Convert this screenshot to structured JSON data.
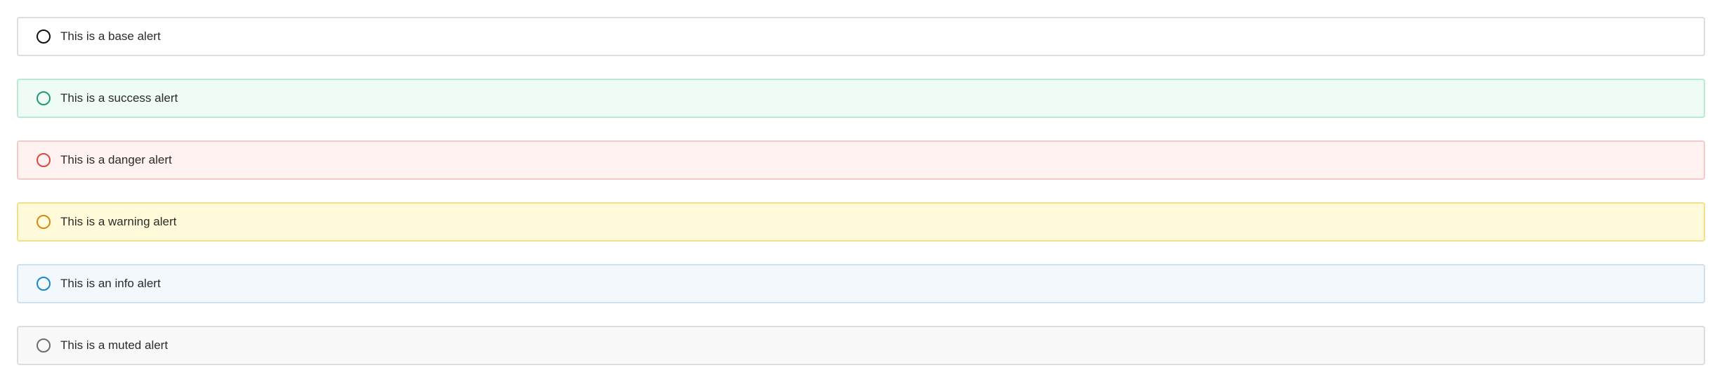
{
  "alerts": [
    {
      "variant": "base",
      "text": "This is a base alert",
      "icon": "circle-outline-icon",
      "background": "#ffffff",
      "border": "#dddddd",
      "icon_color": "#111111"
    },
    {
      "variant": "success",
      "text": "This is a success alert",
      "icon": "circle-outline-icon",
      "background": "#eefcf5",
      "border": "#b9ebd3",
      "icon_color": "#1f9a73"
    },
    {
      "variant": "danger",
      "text": "This is a danger alert",
      "icon": "circle-outline-icon",
      "background": "#fff2f1",
      "border": "#f5c9c7",
      "icon_color": "#e1463d"
    },
    {
      "variant": "warning",
      "text": "This is a warning alert",
      "icon": "circle-outline-icon",
      "background": "#fffad9",
      "border": "#f1df8a",
      "icon_color": "#d48a12"
    },
    {
      "variant": "info",
      "text": "This is an info alert",
      "icon": "circle-outline-icon",
      "background": "#f3f8fc",
      "border": "#cfe1ee",
      "icon_color": "#1987cf"
    },
    {
      "variant": "muted",
      "text": "This is a muted alert",
      "icon": "circle-outline-icon",
      "background": "#f8f8f8",
      "border": "#dddddd",
      "icon_color": "#6d6d6d"
    }
  ]
}
